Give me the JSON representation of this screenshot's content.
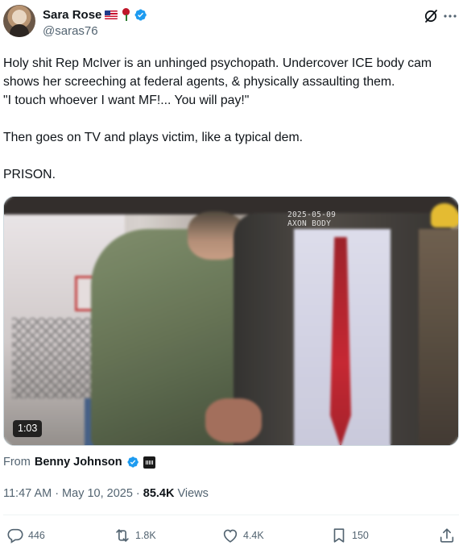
{
  "author": {
    "display_name": "Sara Rose",
    "handle": "@saras76",
    "avatar_icon": "profile-photo",
    "verified_color": "#1d9bf0"
  },
  "tweet": {
    "lines": [
      "Holy shit Rep McIver is an unhinged psychopath. Undercover ICE body cam",
      "shows her screeching at federal agents, & physically assaulting them.",
      "\"I touch whoever I want MF!... You will pay!\"",
      "",
      "Then goes on TV and plays victim, like a typical dem.",
      "",
      "PRISON."
    ]
  },
  "media": {
    "overlay_line1": "2025-05-09",
    "overlay_line2": "AXON BODY",
    "duration": "1:03"
  },
  "attribution": {
    "prefix": "From",
    "name": "Benny Johnson"
  },
  "meta": {
    "time": "11:47 AM",
    "separator": "·",
    "date": "May 10, 2025",
    "views_count": "85.4K",
    "views_label": "Views"
  },
  "actions": {
    "replies": "446",
    "reposts": "1.8K",
    "likes": "4.4K",
    "bookmarks": "150"
  },
  "colors": {
    "text_primary": "#0f1419",
    "text_secondary": "#536471",
    "accent": "#1d9bf0"
  }
}
